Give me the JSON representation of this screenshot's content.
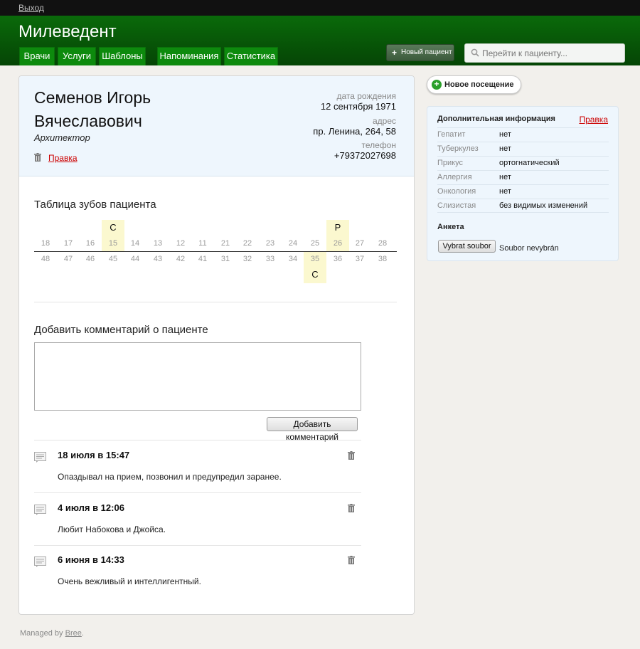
{
  "topbar": {
    "logout": "Выход"
  },
  "app": {
    "title": "Милеведент"
  },
  "nav": {
    "tabs": [
      "Врачи",
      "Услуги",
      "Шаблоны",
      "Напоминания",
      "Статистика"
    ]
  },
  "header": {
    "new_patient": "Новый пациент",
    "search_placeholder": "Перейти к пациенту..."
  },
  "patient": {
    "name_line1": "Семенов Игорь",
    "name_line2": "Вячеславович",
    "profession": "Архитектор",
    "edit": "Правка",
    "birth_label": "дата рождения",
    "birth": "12 сентября 1971",
    "address_label": "адрес",
    "address": "пр. Ленина, 264, 58",
    "phone_label": "телефон",
    "phone": "+79372027698"
  },
  "teeth": {
    "title": "Таблица зубов пациента",
    "upper": [
      "18",
      "17",
      "16",
      "15",
      "14",
      "13",
      "12",
      "11",
      "21",
      "22",
      "23",
      "24",
      "25",
      "26",
      "27",
      "28"
    ],
    "lower": [
      "48",
      "47",
      "46",
      "45",
      "44",
      "43",
      "42",
      "41",
      "31",
      "32",
      "33",
      "34",
      "35",
      "36",
      "37",
      "38"
    ],
    "upper_marks": [
      "",
      "",
      "",
      "С",
      "",
      "",
      "",
      "",
      "",
      "",
      "",
      "",
      "",
      "Р",
      "",
      ""
    ],
    "lower_marks": [
      "",
      "",
      "",
      "",
      "",
      "",
      "",
      "",
      "",
      "",
      "",
      "",
      "С",
      "",
      "",
      ""
    ]
  },
  "comment_form": {
    "title": "Добавить комментарий о пациенте",
    "submit": "Добавить комментарий"
  },
  "comments": [
    {
      "date": "18 июля в 15:47",
      "text": "Опаздывал на прием, позвонил и предупредил заранее."
    },
    {
      "date": "4 июля в 12:06",
      "text": "Любит Набокова и Джойса."
    },
    {
      "date": "6 июня в 14:33",
      "text": "Очень вежливый и интеллигентный."
    }
  ],
  "sidebar": {
    "new_visit": "Новое посещение",
    "info_title": "Дополнительная информация",
    "info_edit": "Правка",
    "rows": [
      {
        "k": "Гепатит",
        "v": "нет"
      },
      {
        "k": "Туберкулез",
        "v": "нет"
      },
      {
        "k": "Прикус",
        "v": "ортогнатический"
      },
      {
        "k": "Аллергия",
        "v": "нет"
      },
      {
        "k": "Онкология",
        "v": "нет"
      },
      {
        "k": "Слизистая",
        "v": "без видимых изменений"
      }
    ],
    "anketa": "Анкета",
    "file_button": "Vybrat soubor",
    "file_status": "Soubor nevybrán"
  },
  "footer": {
    "prefix": "Managed by ",
    "link": "Bree",
    "suffix": "."
  },
  "colors": {
    "header_green": "#0a6a0a",
    "tab_green": "#0d8a0d",
    "link_red": "#cc0000",
    "highlight": "#fbf8cf"
  }
}
